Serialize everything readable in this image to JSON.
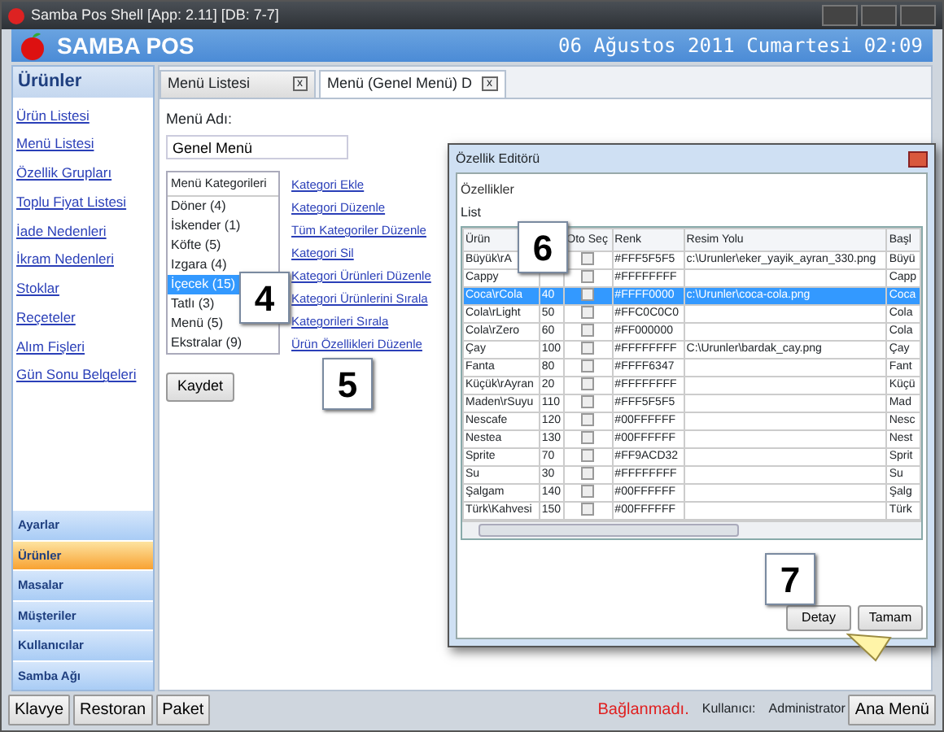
{
  "window": {
    "title": "Samba Pos Shell [App: 2.11] [DB: 7-7]"
  },
  "header": {
    "brand": "SAMBA POS",
    "datetime": "06 Ağustos 2011 Cumartesi 02:09"
  },
  "sidebar": {
    "title": "Ürünler",
    "links": [
      "Ürün Listesi",
      "Menü Listesi",
      "Özellik Grupları",
      "Toplu Fiyat Listesi",
      "İade Nedenleri",
      "İkram Nedenleri",
      "Stoklar",
      "Reçeteler",
      "Alım Fişleri",
      "Gün Sonu Belgeleri"
    ],
    "sections": [
      {
        "label": "Ayarlar",
        "selected": false
      },
      {
        "label": "Ürünler",
        "selected": true
      },
      {
        "label": "Masalar",
        "selected": false
      },
      {
        "label": "Müşteriler",
        "selected": false
      },
      {
        "label": "Kullanıcılar",
        "selected": false
      },
      {
        "label": "Samba Ağı",
        "selected": false
      }
    ]
  },
  "tabs": [
    {
      "label": "Menü Listesi",
      "selected": false,
      "close": "x"
    },
    {
      "label": "Menü (Genel Menü) D",
      "selected": true,
      "close": "x"
    }
  ],
  "form": {
    "label": "Menü Adı:",
    "value": "Genel Menü"
  },
  "categories": {
    "heading": "Menü Kategorileri",
    "items": [
      {
        "label": "Döner (4)",
        "selected": false
      },
      {
        "label": "İskender (1)",
        "selected": false
      },
      {
        "label": "Köfte (5)",
        "selected": false
      },
      {
        "label": "Izgara (4)",
        "selected": false
      },
      {
        "label": "İçecek (15)",
        "selected": true
      },
      {
        "label": "Tatlı (3)",
        "selected": false
      },
      {
        "label": "Menü (5)",
        "selected": false
      },
      {
        "label": "Ekstralar (9)",
        "selected": false
      }
    ]
  },
  "actions": [
    "Kategori Ekle",
    "Kategori Düzenle",
    "Tüm Kategoriler Düzenle",
    "Kategori Sil",
    "Kategori Ürünleri Düzenle",
    "Kategori Ürünlerini Sırala",
    "Kategorileri Sırala",
    "Ürün Özellikleri Düzenle"
  ],
  "save_button": "Kaydet",
  "dialog": {
    "title": "Özellik Editörü",
    "group": "Özellikler",
    "list_label": "List",
    "columns": [
      "Ürün",
      "",
      "Oto Seç",
      "Renk",
      "Resim Yolu",
      "Başl"
    ],
    "rows": [
      {
        "product": "Büyük\\rA",
        "color_code": "#FFF5F5F5",
        "image": "c:\\Urunler\\eker_yayik_ayran_330.png",
        "title": "Büyü",
        "auto_select": false,
        "selected": false
      },
      {
        "product": "Cappy",
        "color_code": "#FFFFFFFF",
        "title": "Capp",
        "auto_select": false,
        "selected": false
      },
      {
        "product": "Coca\\rCola",
        "order": "40",
        "color_code": "#FFFF0000",
        "image": "c:\\Urunler\\coca-cola.png",
        "title": "Coca",
        "auto_select": false,
        "selected": true
      },
      {
        "product": "Cola\\rLight",
        "order": "50",
        "color_code": "#FFC0C0C0",
        "title": "Cola",
        "auto_select": false,
        "selected": false
      },
      {
        "product": "Cola\\rZero",
        "order": "60",
        "color_code": "#FF000000",
        "title": "Cola",
        "auto_select": false,
        "selected": false
      },
      {
        "product": "Çay",
        "order": "100",
        "color_code": "#FFFFFFFF",
        "image": "C:\\Urunler\\bardak_cay.png",
        "title": "Çay",
        "auto_select": false,
        "selected": false
      },
      {
        "product": "Fanta",
        "order": "80",
        "color_code": "#FFFF6347",
        "title": "Fant",
        "auto_select": false,
        "selected": false
      },
      {
        "product": "Küçük\\rAyran",
        "order": "20",
        "color_code": "#FFFFFFFF",
        "title": "Küçü",
        "auto_select": false,
        "selected": false
      },
      {
        "product": "Maden\\rSuyu",
        "order": "110",
        "color_code": "#FFF5F5F5",
        "title": "Mad",
        "auto_select": false,
        "selected": false
      },
      {
        "product": "Nescafe",
        "order": "120",
        "color_code": "#00FFFFFF",
        "title": "Nesc",
        "auto_select": false,
        "selected": false
      },
      {
        "product": "Nestea",
        "order": "130",
        "color_code": "#00FFFFFF",
        "title": "Nest",
        "auto_select": false,
        "selected": false
      },
      {
        "product": "Sprite",
        "order": "70",
        "color_code": "#FF9ACD32",
        "title": "Sprit",
        "auto_select": false,
        "selected": false
      },
      {
        "product": "Su",
        "order": "30",
        "color_code": "#FFFFFFFF",
        "title": "Su",
        "auto_select": false,
        "selected": false
      },
      {
        "product": "Şalgam",
        "order": "140",
        "color_code": "#00FFFFFF",
        "title": "Şalg",
        "auto_select": false,
        "selected": false
      },
      {
        "product": "Türk\\Kahvesi",
        "order": "150",
        "color_code": "#00FFFFFF",
        "title": "Türk",
        "auto_select": false,
        "selected": false
      }
    ],
    "buttons": [
      "Detay",
      "Tamam"
    ]
  },
  "callouts": [
    "4",
    "5",
    "6",
    "7"
  ],
  "footer": {
    "buttons": [
      "Klavye",
      "Restoran",
      "Paket"
    ],
    "status": "Bağlanmadı.",
    "user_label": "Kullanıcı:",
    "user": "Administrator",
    "main_menu": "Ana Menü"
  }
}
